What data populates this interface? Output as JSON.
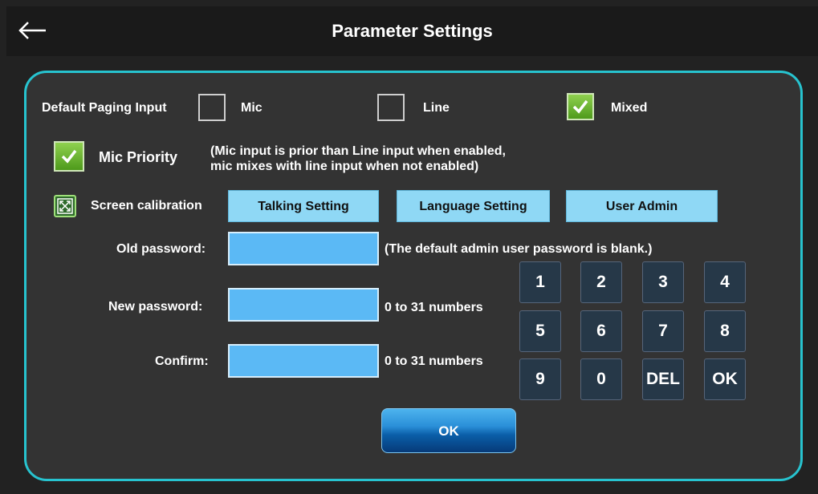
{
  "header": {
    "title": "Parameter Settings",
    "back_icon": "arrow-left-icon"
  },
  "paging_input": {
    "label": "Default Paging Input",
    "options": [
      {
        "label": "Mic",
        "checked": false
      },
      {
        "label": "Line",
        "checked": false
      },
      {
        "label": "Mixed",
        "checked": true
      }
    ]
  },
  "mic_priority": {
    "label": "Mic Priority",
    "checked": true,
    "note_line1": "(Mic input is prior than Line input when enabled,",
    "note_line2": "mic mixes with line input when not enabled)"
  },
  "toolbar": {
    "calibration_label": "Screen calibration",
    "calibration_icon": "screen-calibration-icon",
    "talking_label": "Talking Setting",
    "language_label": "Language Setting",
    "user_admin_label": "User Admin"
  },
  "password": {
    "old_label": "Old password:",
    "old_value": "",
    "old_hint": "(The default admin user password is blank.)",
    "new_label": "New password:",
    "new_value": "",
    "new_hint": "0 to 31 numbers",
    "confirm_label": "Confirm:",
    "confirm_value": "",
    "confirm_hint": "0 to 31 numbers"
  },
  "keypad": {
    "keys": [
      "1",
      "2",
      "3",
      "4",
      "5",
      "6",
      "7",
      "8",
      "9",
      "0",
      "DEL",
      "OK"
    ]
  },
  "footer": {
    "ok_label": "OK"
  },
  "colors": {
    "panel_border": "#27c3cf",
    "button_light_blue": "#8fd8f5",
    "input_blue": "#5bb9f5",
    "check_green": "#6ab830",
    "key_bg": "#263848"
  }
}
